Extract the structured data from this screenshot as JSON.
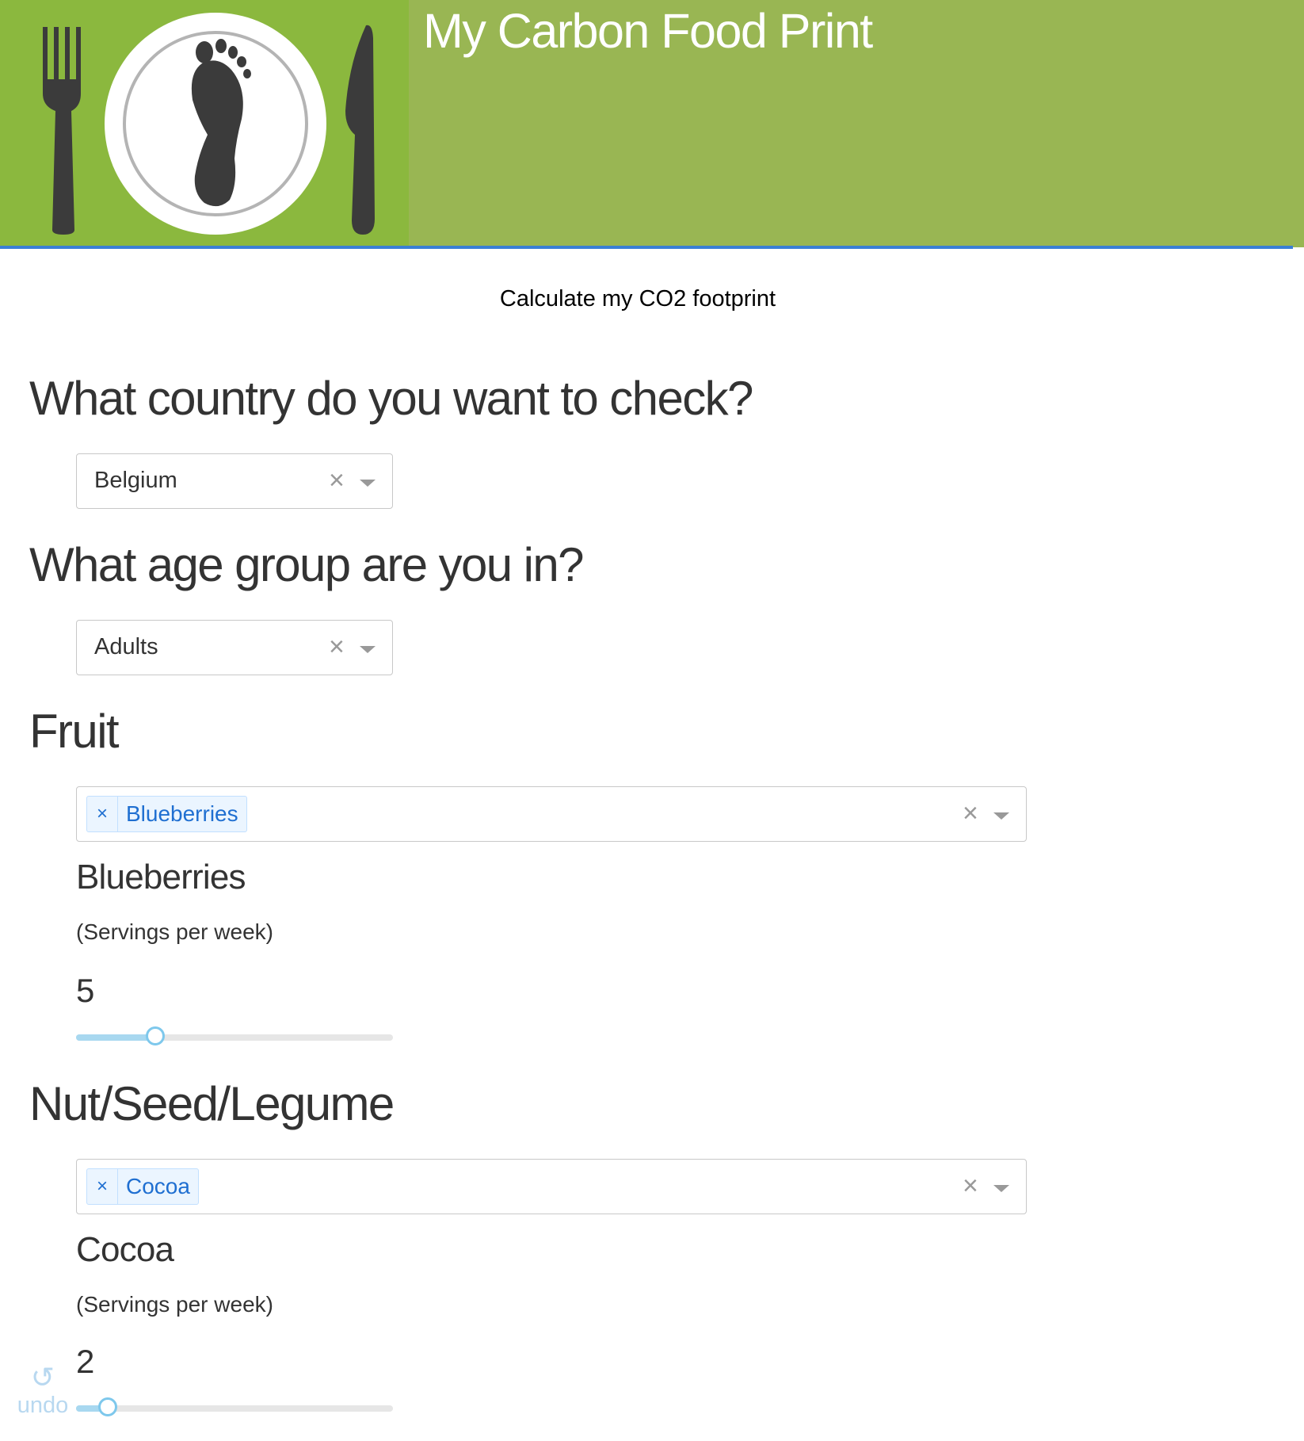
{
  "header": {
    "title": "My Carbon Food Print"
  },
  "nav": {
    "calculate_link": "Calculate my CO2 footprint"
  },
  "country": {
    "question": "What country do you want to check?",
    "selected": "Belgium"
  },
  "age": {
    "question": "What age group are you in?",
    "selected": "Adults"
  },
  "fruit": {
    "heading": "Fruit",
    "tag": "Blueberries",
    "tag_remove": "×",
    "item": {
      "name": "Blueberries",
      "unit": "(Servings per week)",
      "value": "5",
      "fraction": 0.25
    }
  },
  "nut": {
    "heading": "Nut/Seed/Legume",
    "tag": "Cocoa",
    "tag_remove": "×",
    "item": {
      "name": "Cocoa",
      "unit": "(Servings per week)",
      "value": "2",
      "fraction": 0.1
    }
  },
  "controls": {
    "clear": "×",
    "undo_label": "undo"
  },
  "icons": {
    "logo": "fork-plate-footprint-knife",
    "clear": "close-icon",
    "dropdown": "chevron-down-icon",
    "undo": "undo-icon"
  },
  "colors": {
    "header_bg": "#99b653",
    "logo_bg": "#8bb83e",
    "header_line": "#3a7fd5",
    "tag_text": "#1f6fd1",
    "slider_fill": "#a8d8f0"
  }
}
